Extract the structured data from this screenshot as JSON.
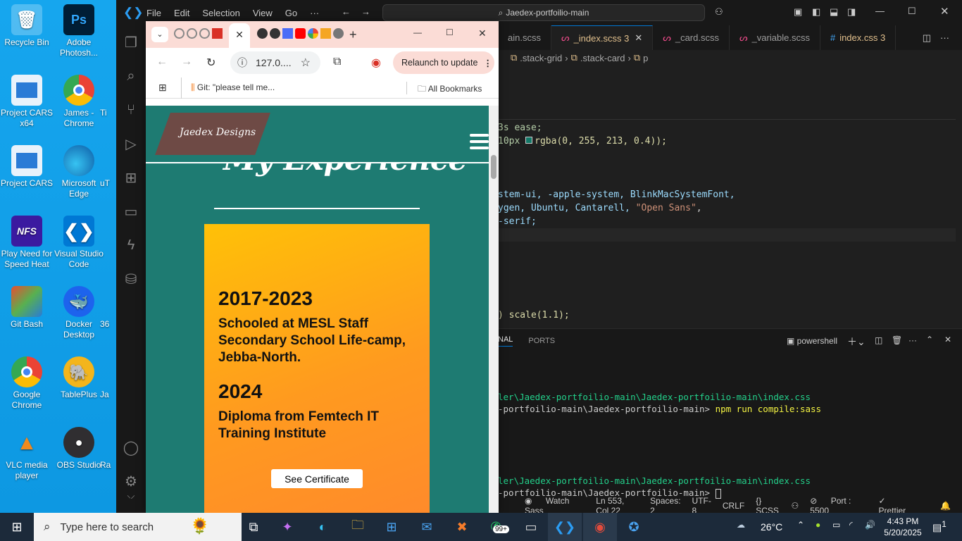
{
  "desktop": {
    "icons": [
      {
        "label": "Recycle Bin",
        "name": "recycle-bin-icon"
      },
      {
        "label": "Adobe Photosh...",
        "name": "photoshop-icon"
      },
      {
        "label": "Project CARS x64",
        "name": "project-cars-x64-icon"
      },
      {
        "label": "James - Chrome",
        "name": "chrome-profile-icon"
      },
      {
        "label": "Project CARS",
        "name": "project-cars-icon"
      },
      {
        "label": "Microsoft Edge",
        "name": "edge-icon"
      },
      {
        "label": "Play Need for Speed Heat",
        "name": "nfs-icon"
      },
      {
        "label": "Visual Studio Code",
        "name": "vscode-icon"
      },
      {
        "label": "Git Bash",
        "name": "git-bash-icon"
      },
      {
        "label": "Docker Desktop",
        "name": "docker-icon"
      },
      {
        "label": "Google Chrome",
        "name": "chrome-icon"
      },
      {
        "label": "TablePlus",
        "name": "tableplus-icon"
      },
      {
        "label": "VLC media player",
        "name": "vlc-icon"
      },
      {
        "label": "OBS Studio",
        "name": "obs-icon"
      }
    ],
    "partial_labels": [
      "Ti",
      "uT",
      "36",
      "Ja",
      "Ra"
    ]
  },
  "vscode": {
    "menu": [
      "File",
      "Edit",
      "Selection",
      "View",
      "Go",
      "···"
    ],
    "search": "Jaedex-portfoilio-main",
    "tabs": [
      {
        "label": "ain.scss",
        "badge": ""
      },
      {
        "label": "_index.scss",
        "badge": "3"
      },
      {
        "label": "_card.scss",
        "badge": ""
      },
      {
        "label": "_variable.scss",
        "badge": ""
      },
      {
        "label": "index.css",
        "badge": "3"
      }
    ],
    "breadcrumb": [
      ".stack-grid",
      ".stack-card",
      "p"
    ],
    "code": {
      "l1": "3s ease;",
      "l2a": "10px ",
      "l2b": "rgba(0, 255, 213, 0.4));",
      "l3": "stem-ui, -apple-system, BlinkMacSystemFont,",
      "l4a": "ygen, Ubuntu, Cantarell, ",
      "l4b": "\"Open Sans\"",
      "l4c": ",",
      "l5": "-serif;",
      "l6": ") scale(1.1);"
    },
    "panel_tabs": [
      "NAL",
      "PORTS"
    ],
    "terminal_name": "powershell",
    "terminal": [
      "ler\\Jaedex-portfoilio-main\\Jaedex-portfoilio-main\\index.css",
      "-portfoilio-main\\Jaedex-portfoilio-main> ",
      "npm run compile:sass",
      "ler\\Jaedex-portfoilio-main\\Jaedex-portfoilio-main\\index.css",
      "-portfoilio-main\\Jaedex-portfoilio-main> "
    ],
    "status": [
      "Watch Sass",
      "Ln 553, Col 22",
      "Spaces: 2",
      "UTF-8",
      "CRLF",
      "{} SCSS",
      "Port : 5500",
      "Prettier"
    ]
  },
  "chrome": {
    "address": "127.0....",
    "relaunch": "Relaunch to update",
    "bookmarks": [
      "Git: \"please tell me...",
      "All Bookmarks"
    ],
    "site": {
      "logo": "Jaedex Designs",
      "section_title": "My Experience",
      "entries": [
        {
          "year": "2017-2023",
          "text": "Schooled at MESL Staff Secondary School Life-camp, Jebba-North."
        },
        {
          "year": "2024",
          "text": "Diploma from Femtech IT Training Institute"
        }
      ],
      "cert_button": "See Certificate"
    }
  },
  "taskbar": {
    "search_placeholder": "Type here to search",
    "badge": "99+",
    "weather": "26°C",
    "time": "4:43 PM",
    "date": "5/20/2025",
    "notifications": "1"
  }
}
